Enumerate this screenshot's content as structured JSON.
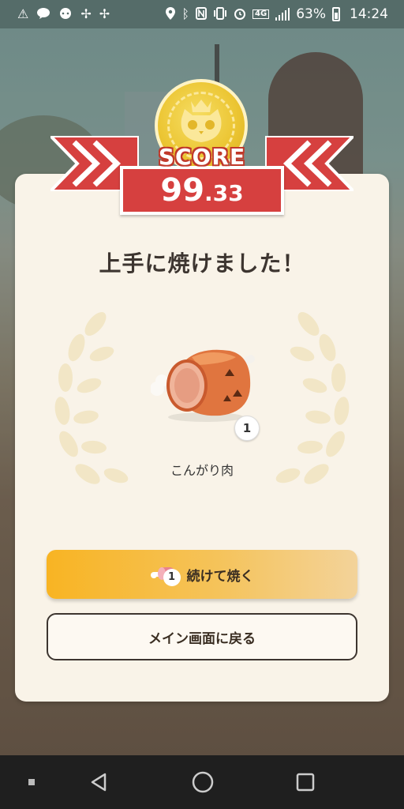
{
  "status_bar": {
    "notification_icons": [
      "warning-icon",
      "line-icon",
      "chat-icon",
      "pinwheel-icon",
      "pinwheel-icon"
    ],
    "system_icons": [
      "location-icon",
      "bluetooth-icon",
      "nfc-icon",
      "vibrate-icon",
      "alarm-icon",
      "4g-icon",
      "signal-icon"
    ],
    "network_label": "4G",
    "battery": "63%",
    "time": "14:24"
  },
  "score": {
    "label": "SCORE",
    "value_int": "99",
    "value_dec": ".33"
  },
  "result": {
    "title": "上手に焼けました！",
    "item_name": "こんがり肉",
    "item_quantity": "1"
  },
  "buttons": {
    "continue_label": "続けて焼く",
    "continue_cost": "1",
    "back_label": "メイン画面に戻る"
  },
  "nav": {
    "items": [
      "recent-apps-icon",
      "back-icon",
      "home-icon",
      "overview-icon"
    ]
  },
  "colors": {
    "banner_red": "#d6403f",
    "gold": "#ecc634",
    "primary_button": "#f8b423",
    "card": "#f9f3e8"
  }
}
